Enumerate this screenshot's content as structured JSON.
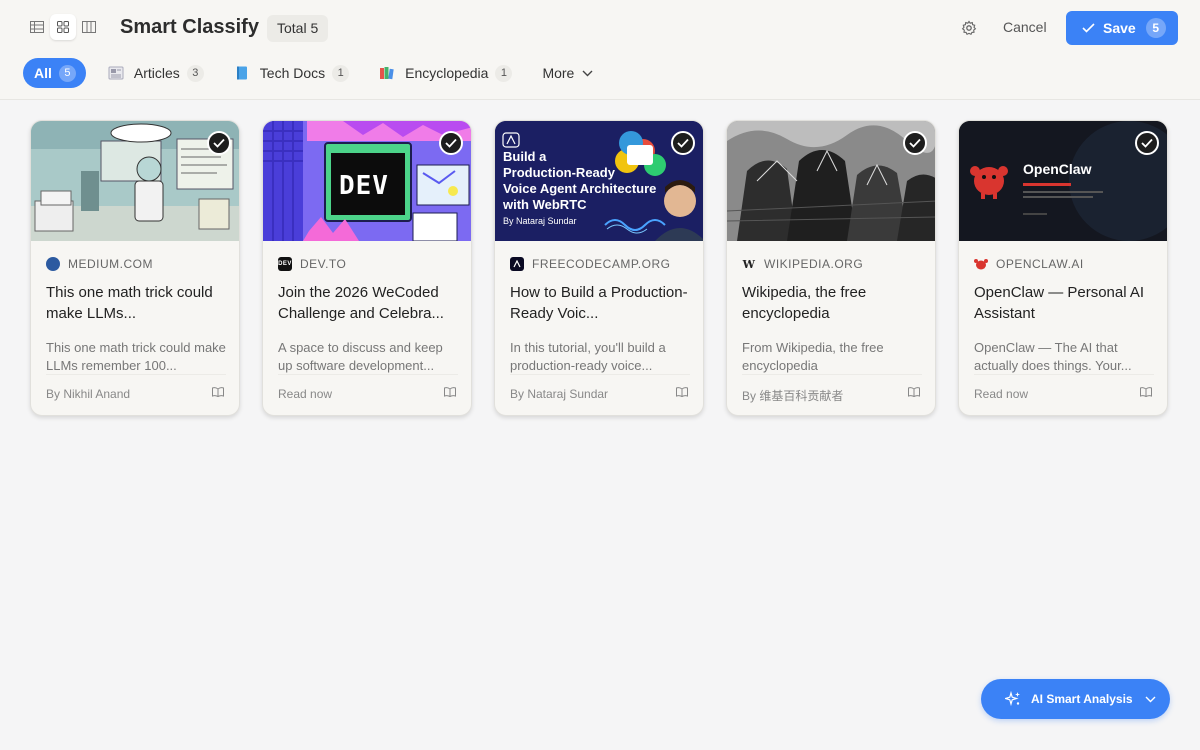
{
  "header": {
    "title": "Smart Classify",
    "total_label": "Total 5",
    "cancel_label": "Cancel",
    "save_label": "Save",
    "save_count": "5"
  },
  "tabs": [
    {
      "label": "All",
      "count": "5",
      "active": true
    },
    {
      "label": "Articles",
      "count": "3",
      "icon": "newspaper-icon"
    },
    {
      "label": "Tech Docs",
      "count": "1",
      "icon": "book-icon"
    },
    {
      "label": "Encyclopedia",
      "count": "1",
      "icon": "books-icon"
    },
    {
      "label": "More",
      "icon": "chevron-down-icon"
    }
  ],
  "cards": [
    {
      "source": "MEDIUM.COM",
      "title": "This one math trick could make LLMs...",
      "desc": "This one math trick could make LLMs remember 100...",
      "footer": "By Nikhil Anand",
      "thumb_text": "",
      "thumb_lines": []
    },
    {
      "source": "DEV.TO",
      "title": "Join the 2026 WeCoded Challenge and Celebra...",
      "desc": "A space to discuss and keep up software development...",
      "footer": "Read now",
      "thumb_text": "DEV",
      "thumb_lines": []
    },
    {
      "source": "FREECODECAMP.ORG",
      "title": "How to Build a Production-Ready Voic...",
      "desc": "In this tutorial, you'll build a production-ready voice...",
      "footer": "By Nataraj Sundar",
      "thumb_text": "",
      "thumb_lines": [
        "Build a",
        "Production-Ready",
        "Voice Agent Architecture",
        "with WebRTC"
      ],
      "thumb_byline": "By Nataraj Sundar"
    },
    {
      "source": "WIKIPEDIA.ORG",
      "title": "Wikipedia, the free encyclopedia",
      "desc": "From Wikipedia, the free encyclopedia",
      "footer": "By 维基百科贡献者",
      "thumb_text": "",
      "thumb_lines": []
    },
    {
      "source": "OPENCLAW.AI",
      "title": "OpenClaw — Personal AI Assistant",
      "desc": "OpenClaw — The AI that actually does things. Your...",
      "footer": "Read now",
      "thumb_text": "OpenClaw",
      "thumb_lines": []
    }
  ],
  "ai_button": {
    "label": "AI Smart Analysis"
  },
  "colors": {
    "accent": "#3b82f6"
  }
}
